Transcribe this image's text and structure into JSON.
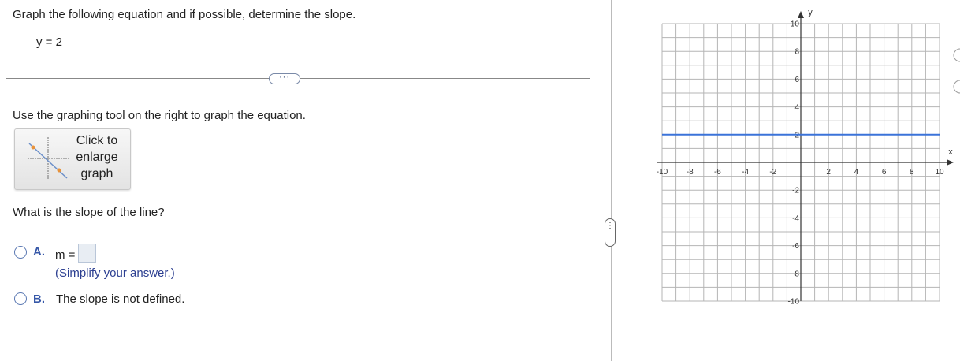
{
  "question": {
    "instruction": "Graph the following equation and if possible, determine the slope.",
    "equation": "y = 2",
    "more_button": "···",
    "use_tool": "Use the graphing tool on the right to graph the equation.",
    "enlarge_button": "Click to enlarge graph",
    "slope_question": "What is the slope of the line?"
  },
  "options": {
    "a": {
      "letter": "A.",
      "prefix": "m =",
      "answer_value": "",
      "hint": "(Simplify your answer.)"
    },
    "b": {
      "letter": "B.",
      "text": "The slope is not defined."
    }
  },
  "panel_handle": "⋮",
  "colors": {
    "accent": "#3758a8",
    "line": "#3b73d9",
    "grid": "#b5b5b5",
    "radio": "#5b79b3"
  },
  "chart_data": {
    "type": "line",
    "xlabel": "x",
    "ylabel": "y",
    "xlim": [
      -10,
      10
    ],
    "ylim": [
      -10,
      10
    ],
    "grid": true,
    "x_ticks": [
      -10,
      -8,
      -6,
      -4,
      -2,
      2,
      4,
      6,
      8,
      10
    ],
    "y_ticks": [
      10,
      8,
      6,
      4,
      2,
      -2,
      -4,
      -6,
      -8,
      -10
    ],
    "series": [
      {
        "x": [
          -10,
          10
        ],
        "y": [
          2,
          2
        ]
      }
    ]
  }
}
